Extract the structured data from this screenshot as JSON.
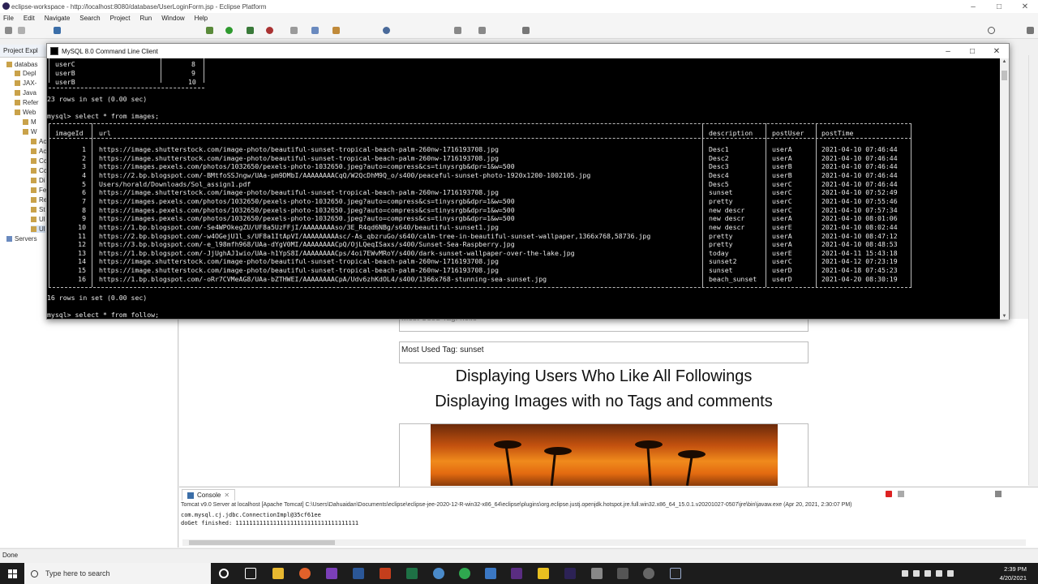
{
  "eclipse": {
    "title": "eclipse-workspace - http://localhost:8080/database/UserLoginForm.jsp - Eclipse Platform",
    "menu": [
      "File",
      "Edit",
      "Navigate",
      "Search",
      "Project",
      "Run",
      "Window",
      "Help"
    ],
    "explorer_tab": "Project Expl",
    "tree": [
      "databas",
      "Depl",
      "JAX-",
      "Java",
      "Refer",
      "Refer",
      "Web",
      "M",
      "W",
      "Ac",
      "Ac",
      "Cc",
      "Cc",
      "Di",
      "Fe",
      "Re",
      "St",
      "Ul",
      "Ul",
      "Servers"
    ],
    "status": "Done"
  },
  "browser": {
    "tag_hidden": "Most Used Tag: hello",
    "tag_sunset": "Most Used Tag: sunset",
    "heading1": "Displaying Users Who Like All Followings",
    "heading2": "Displaying Images with no Tags and comments"
  },
  "console": {
    "tab": "Console",
    "info": "Tomcat v9.0 Server at localhost [Apache Tomcat] C:\\Users\\Dahuaidan\\Documents\\eclipse\\eclipse-jee-2020-12-R-win32-x86_64\\eclipse\\plugins\\org.eclipse.justj.openjdk.hotspot.jre.full.win32.x86_64_15.0.1.v20201027-0507\\jre\\bin\\javaw.exe (Apr 20, 2021, 2:30:07 PM)",
    "lines": [
      "com.mysql.cj.jdbc.ConnectionImpl@35cf61ee",
      "doGet finished: 111111111111111111111111111111111111"
    ]
  },
  "mysql": {
    "title": "MySQL 8.0 Command Line Client",
    "prev_rows": [
      [
        "userC",
        "8"
      ],
      [
        "userB",
        "9"
      ],
      [
        "userB",
        "10"
      ]
    ],
    "prev_summary": "23 rows in set (0.00 sec)",
    "query1": "mysql> select * from images;",
    "columns": [
      "imageId",
      "url",
      "description",
      "postUser",
      "postTime"
    ],
    "rows": [
      [
        "1",
        "https://image.shutterstock.com/image-photo/beautiful-sunset-tropical-beach-palm-260nw-1716193708.jpg",
        "Desc1",
        "userA",
        "2021-04-10 07:46:44"
      ],
      [
        "2",
        "https://image.shutterstock.com/image-photo/beautiful-sunset-tropical-beach-palm-260nw-1716193708.jpg",
        "Desc2",
        "userA",
        "2021-04-10 07:46:44"
      ],
      [
        "3",
        "https://images.pexels.com/photos/1032650/pexels-photo-1032650.jpeg?auto=compress&cs=tinysrgb&dpr=1&w=500",
        "Desc3",
        "userB",
        "2021-04-10 07:46:44"
      ],
      [
        "4",
        "https://2.bp.blogspot.com/-BMtfoSSJngw/UAa-pm9DMbI/AAAAAAAACqQ/W2QcDhM9Q_o/s400/peaceful-sunset-photo-1920x1200-1002105.jpg",
        "Desc4",
        "userB",
        "2021-04-10 07:46:44"
      ],
      [
        "5",
        "Users/horald/Downloads/Sol_assign1.pdf",
        "Desc5",
        "userC",
        "2021-04-10 07:46:44"
      ],
      [
        "6",
        "https://image.shutterstock.com/image-photo/beautiful-sunset-tropical-beach-palm-260nw-1716193708.jpg",
        "sunset",
        "userC",
        "2021-04-10 07:52:49"
      ],
      [
        "7",
        "https://images.pexels.com/photos/1032650/pexels-photo-1032650.jpeg?auto=compress&cs=tinysrgb&dpr=1&w=500",
        "pretty",
        "userC",
        "2021-04-10 07:55:46"
      ],
      [
        "8",
        "https://images.pexels.com/photos/1032650/pexels-photo-1032650.jpeg?auto=compress&cs=tinysrgb&dpr=1&w=500",
        "new descr",
        "userC",
        "2021-04-10 07:57:34"
      ],
      [
        "9",
        "https://images.pexels.com/photos/1032650/pexels-photo-1032650.jpeg?auto=compress&cs=tinysrgb&dpr=1&w=500",
        "new descr",
        "userA",
        "2021-04-10 08:01:06"
      ],
      [
        "10",
        "https://1.bp.blogspot.com/-Se4WPOkegZU/UF8a5UzFFjI/AAAAAAAAso/3E_R4qd6NBg/s640/beautiful-sunset1.jpg",
        "new descr",
        "userE",
        "2021-04-10 08:02:44"
      ],
      [
        "11",
        "https://2.bp.blogspot.com/-w4OGejU1l_s/UF8a1ItApVI/AAAAAAAAAsc/-As_qbzruGo/s640/calm-tree-in-beautiful-sunset-wallpaper,1366x768,58736.jpg",
        "pretty",
        "userA",
        "2021-04-10 08:47:12"
      ],
      [
        "12",
        "https://3.bp.blogspot.com/-e_l98mfh968/UAa-dYgV0MI/AAAAAAAACpQ/OjLQeqISaxs/s400/Sunset-Sea-Raspberry.jpg",
        "pretty",
        "userA",
        "2021-04-10 08:48:53"
      ],
      [
        "13",
        "https://1.bp.blogspot.com/-JjUghAJ1wio/UAa-h1YpS8I/AAAAAAAACps/4oi7EWvMRoY/s400/dark-sunset-wallpaper-over-the-lake.jpg",
        "today",
        "userE",
        "2021-04-11 15:43:18"
      ],
      [
        "14",
        "https://image.shutterstock.com/image-photo/beautiful-sunset-tropical-beach-palm-260nw-1716193708.jpg",
        "sunset2",
        "userC",
        "2021-04-12 07:23:19"
      ],
      [
        "15",
        "https://image.shutterstock.com/image-photo/beautiful-sunset-tropical-beach-palm-260nw-1716193708.jpg",
        "sunset",
        "userD",
        "2021-04-18 07:45:23"
      ],
      [
        "16",
        "https://1.bp.blogspot.com/-oRr7CVMeAG8/UAa-bZTHWEI/AAAAAAAACpA/Udv6zhKdOL4/s400/1366x768-stunning-sea-sunset.jpg",
        "beach_sunset",
        "userD",
        "2021-04-20 08:30:19"
      ]
    ],
    "summary": "16 rows in set (0.00 sec)",
    "query2": "mysql> select * from follow;"
  },
  "taskbar": {
    "search_placeholder": "Type here to search",
    "time": "2:39 PM",
    "date": "4/20/2021"
  }
}
